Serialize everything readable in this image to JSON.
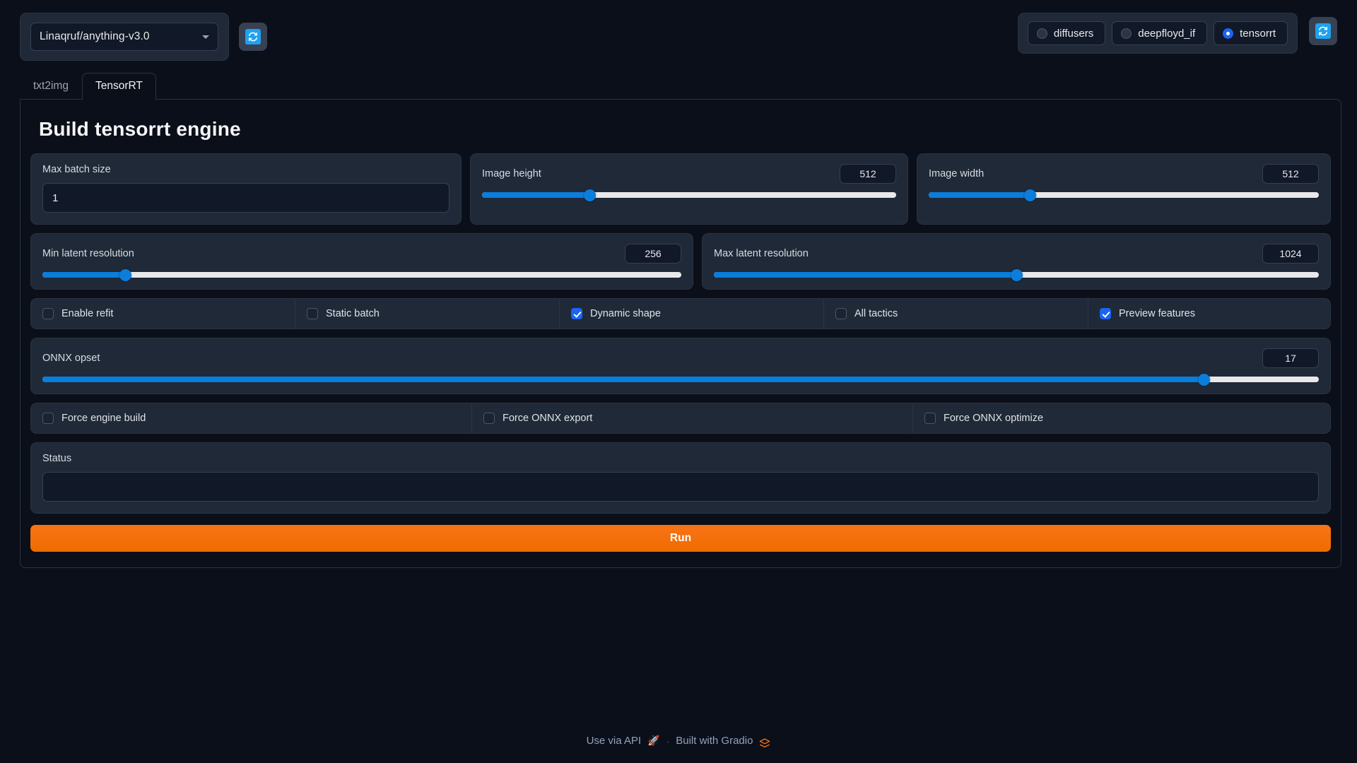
{
  "topbar": {
    "model_dropdown": {
      "name": "stable-diffusion-checkpoint",
      "value": "Linaqruf/anything-v3.0",
      "caret_icon": "chevron-down-icon"
    },
    "refresh_model_button": {
      "icon": "refresh-icon",
      "title": "Refresh model list"
    },
    "backend_radio": {
      "options": [
        "diffusers",
        "deepfloyd_if",
        "tensorrt"
      ],
      "selected": "tensorrt"
    },
    "refresh_backend_button": {
      "icon": "refresh-icon",
      "title": "Refresh backend"
    }
  },
  "tabs": [
    {
      "label": "txt2img",
      "active": false
    },
    {
      "label": "TensorRT",
      "active": true
    }
  ],
  "page_title": "Build tensorrt engine",
  "fields": {
    "max_batch_size": {
      "label": "Max batch size",
      "value": "1"
    },
    "image_height": {
      "label": "Image height",
      "value": "512",
      "fill_pct": 26
    },
    "image_width": {
      "label": "Image width",
      "value": "512",
      "fill_pct": 26
    },
    "min_latent_resolution": {
      "label": "Min latent resolution",
      "value": "256",
      "fill_pct": 13
    },
    "max_latent_resolution": {
      "label": "Max latent resolution",
      "value": "1024",
      "fill_pct": 50
    },
    "onnx_opset": {
      "label": "ONNX opset",
      "value": "17",
      "fill_pct": 91
    },
    "status": {
      "label": "Status",
      "value": ""
    }
  },
  "checkboxes_primary": [
    {
      "label": "Enable refit",
      "checked": false
    },
    {
      "label": "Static batch",
      "checked": false
    },
    {
      "label": "Dynamic shape",
      "checked": true
    },
    {
      "label": "All tactics",
      "checked": false
    },
    {
      "label": "Preview features",
      "checked": true
    }
  ],
  "checkboxes_force": [
    {
      "label": "Force engine build",
      "checked": false
    },
    {
      "label": "Force ONNX export",
      "checked": false
    },
    {
      "label": "Force ONNX optimize",
      "checked": false
    }
  ],
  "run_button": {
    "label": "Run"
  },
  "footer": {
    "use_via_api": "Use via API",
    "api_emoji": "🚀",
    "separator": "·",
    "built_with": "Built with Gradio",
    "logo_icon": "gradio-logo-icon"
  },
  "colors": {
    "accent_blue": "#1c64f2",
    "slider_blue": "#0b7ddb",
    "run_orange": "#f97316",
    "page_bg": "#0b0f19",
    "panel_bg": "#1f2937",
    "input_bg": "#111827",
    "border": "#2a3442"
  }
}
